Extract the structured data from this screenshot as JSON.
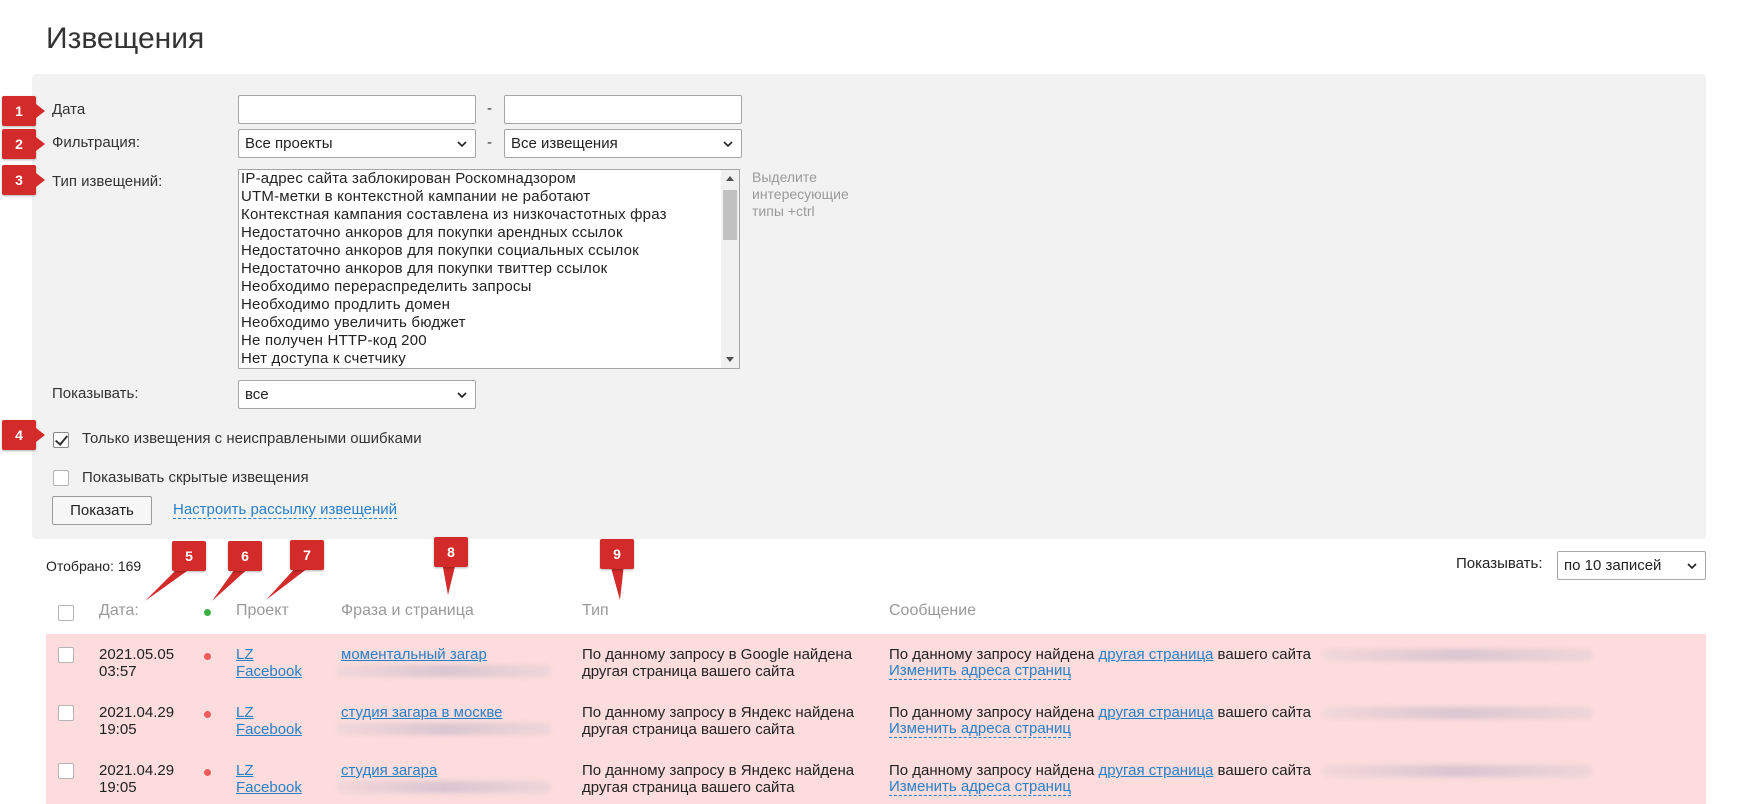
{
  "page": {
    "title": "Извещения"
  },
  "filters": {
    "date_label": "Дата",
    "date_from": "",
    "date_to": "",
    "date_separator": "-",
    "filter_label": "Фильтрация:",
    "projects_select": "Все проекты",
    "notices_select": "Все извещения",
    "type_label": "Тип извещений:",
    "type_options": [
      "IP-адрес сайта заблокирован Роскомнадзором",
      "UTM-метки в контекстной кампании не работают",
      "Контекстная кампания составлена из низкочастотных фраз",
      "Недостаточно анкоров для покупки арендных ссылок",
      "Недостаточно анкоров для покупки социальных ссылок",
      "Недостаточно анкоров для покупки твиттер ссылок",
      "Необходимо перераспределить запросы",
      "Необходимо продлить домен",
      "Необходимо увеличить бюджет",
      "Не получен HTTP-код 200",
      "Нет доступа к счетчику"
    ],
    "type_hint": "Выделите интересующие типы +ctrl",
    "show_label": "Показывать:",
    "show_select": "все",
    "only_unfixed_label": "Только извещения с неисправлеными ошибками",
    "only_unfixed_checked": true,
    "show_hidden_label": "Показывать скрытые извещения",
    "show_hidden_checked": false,
    "submit_label": "Показать",
    "mailing_link": "Настроить рассылку извещений"
  },
  "markers": [
    "1",
    "2",
    "3",
    "4",
    "5",
    "6",
    "7",
    "8",
    "9"
  ],
  "summary": {
    "count_text": "Отобрано: 169",
    "per_page_label": "Показывать:",
    "per_page_select": "по 10 записей"
  },
  "table": {
    "headers": {
      "date": "Дата:",
      "project": "Проект",
      "phrase": "Фраза и страница",
      "type": "Тип",
      "message": "Сообщение"
    },
    "status_colors": {
      "header_dot": "#3cb043",
      "row_dot": "#ef5b5b",
      "row_bg": "#fcdcdc",
      "link": "#2a7fc6",
      "marker": "#d32a2a"
    },
    "rows": [
      {
        "date": "2021.05.05",
        "time": "03:57",
        "project_1": "LZ",
        "project_2": "Facebook",
        "phrase": "моментальный загар",
        "type_1": "По данному запросу в Google найдена",
        "type_2": "другая страница вашего сайта",
        "msg_pre": "По данному запросу найдена ",
        "msg_link": "другая страница",
        "msg_post": " вашего сайта",
        "msg_action": "Изменить адреса страниц"
      },
      {
        "date": "2021.04.29",
        "time": "19:05",
        "project_1": "LZ",
        "project_2": "Facebook",
        "phrase": "студия загара в москве",
        "type_1": "По данному запросу в Яндекс найдена",
        "type_2": "другая страница вашего сайта",
        "msg_pre": "По данному запросу найдена ",
        "msg_link": "другая страница",
        "msg_post": " вашего сайта",
        "msg_action": "Изменить адреса страниц"
      },
      {
        "date": "2021.04.29",
        "time": "19:05",
        "project_1": "LZ",
        "project_2": "Facebook",
        "phrase": "студия загара",
        "type_1": "По данному запросу в Яндекс найдена",
        "type_2": "другая страница вашего сайта",
        "msg_pre": "По данному запросу найдена ",
        "msg_link": "другая страница",
        "msg_post": " вашего сайта",
        "msg_action": "Изменить адреса страниц"
      }
    ]
  }
}
